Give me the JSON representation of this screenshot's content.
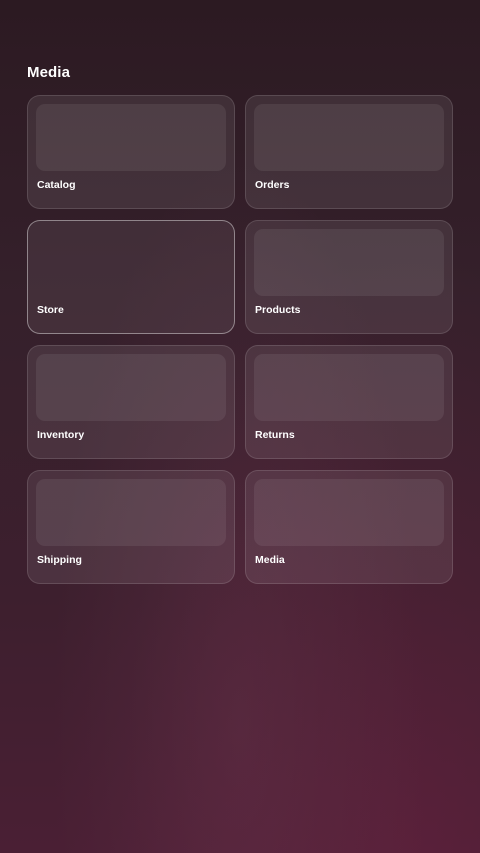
{
  "section": {
    "title": "Media"
  },
  "tiles": [
    {
      "label": "Catalog"
    },
    {
      "label": "Orders"
    },
    {
      "label": "Store"
    },
    {
      "label": "Products"
    },
    {
      "label": "Inventory"
    },
    {
      "label": "Returns"
    },
    {
      "label": "Shipping"
    },
    {
      "label": "Media"
    }
  ]
}
